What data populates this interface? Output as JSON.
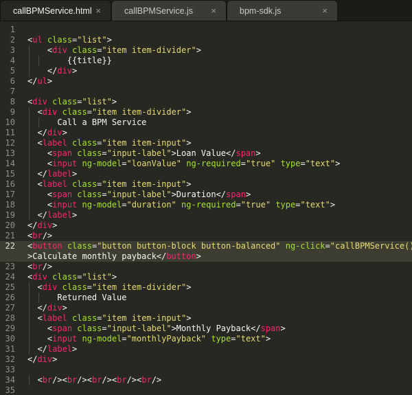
{
  "tabs": [
    {
      "label": "callBPMService.html",
      "close": "×",
      "active": true
    },
    {
      "label": "callBPMService.js",
      "close": "×",
      "active": false
    },
    {
      "label": "bpm-sdk.js",
      "close": "×",
      "active": false
    }
  ],
  "editor": {
    "current_line": 22,
    "lines": [
      {
        "n": "1",
        "indent": 0,
        "tokens": []
      },
      {
        "n": "2",
        "indent": 0,
        "tokens": [
          [
            "p",
            "<"
          ],
          [
            "t",
            "ul"
          ],
          [
            "p",
            " "
          ],
          [
            "a",
            "class"
          ],
          [
            "p",
            "="
          ],
          [
            "s",
            "\"list\""
          ],
          [
            "p",
            ">"
          ]
        ]
      },
      {
        "n": "3",
        "indent": 2,
        "tokens": [
          [
            "p",
            "<"
          ],
          [
            "t",
            "div"
          ],
          [
            "p",
            " "
          ],
          [
            "a",
            "class"
          ],
          [
            "p",
            "="
          ],
          [
            "s",
            "\"item item-divider\""
          ],
          [
            "p",
            ">"
          ]
        ]
      },
      {
        "n": "4",
        "indent": 4,
        "tokens": [
          [
            "p",
            "{{title}}"
          ]
        ]
      },
      {
        "n": "5",
        "indent": 2,
        "tokens": [
          [
            "p",
            "</"
          ],
          [
            "t",
            "div"
          ],
          [
            "p",
            ">"
          ]
        ]
      },
      {
        "n": "6",
        "indent": 0,
        "tokens": [
          [
            "p",
            "</"
          ],
          [
            "t",
            "ul"
          ],
          [
            "p",
            ">"
          ]
        ]
      },
      {
        "n": "7",
        "indent": 0,
        "tokens": []
      },
      {
        "n": "8",
        "indent": 0,
        "tokens": [
          [
            "p",
            "<"
          ],
          [
            "t",
            "div"
          ],
          [
            "p",
            " "
          ],
          [
            "a",
            "class"
          ],
          [
            "p",
            "="
          ],
          [
            "s",
            "\"list\""
          ],
          [
            "p",
            ">"
          ]
        ]
      },
      {
        "n": "9",
        "indent": 1,
        "tokens": [
          [
            "p",
            "<"
          ],
          [
            "t",
            "div"
          ],
          [
            "p",
            " "
          ],
          [
            "a",
            "class"
          ],
          [
            "p",
            "="
          ],
          [
            "s",
            "\"item item-divider\""
          ],
          [
            "p",
            ">"
          ]
        ]
      },
      {
        "n": "10",
        "indent": 3,
        "tokens": [
          [
            "p",
            "Call a BPM Service"
          ]
        ]
      },
      {
        "n": "11",
        "indent": 1,
        "tokens": [
          [
            "p",
            "</"
          ],
          [
            "t",
            "div"
          ],
          [
            "p",
            ">"
          ]
        ]
      },
      {
        "n": "12",
        "indent": 1,
        "tokens": [
          [
            "p",
            "<"
          ],
          [
            "t",
            "label"
          ],
          [
            "p",
            " "
          ],
          [
            "a",
            "class"
          ],
          [
            "p",
            "="
          ],
          [
            "s",
            "\"item item-input\""
          ],
          [
            "p",
            ">"
          ]
        ]
      },
      {
        "n": "13",
        "indent": 2,
        "tokens": [
          [
            "p",
            "<"
          ],
          [
            "t",
            "span"
          ],
          [
            "p",
            " "
          ],
          [
            "a",
            "class"
          ],
          [
            "p",
            "="
          ],
          [
            "s",
            "\"input-label\""
          ],
          [
            "p",
            ">Loan Value</"
          ],
          [
            "t",
            "span"
          ],
          [
            "p",
            ">"
          ]
        ]
      },
      {
        "n": "14",
        "indent": 2,
        "tokens": [
          [
            "p",
            "<"
          ],
          [
            "t",
            "input"
          ],
          [
            "p",
            " "
          ],
          [
            "a",
            "ng-model"
          ],
          [
            "p",
            "="
          ],
          [
            "s",
            "\"loanValue\""
          ],
          [
            "p",
            " "
          ],
          [
            "a",
            "ng-required"
          ],
          [
            "p",
            "="
          ],
          [
            "s",
            "\"true\""
          ],
          [
            "p",
            " "
          ],
          [
            "a",
            "type"
          ],
          [
            "p",
            "="
          ],
          [
            "s",
            "\"text\""
          ],
          [
            "p",
            ">"
          ]
        ]
      },
      {
        "n": "15",
        "indent": 1,
        "tokens": [
          [
            "p",
            "</"
          ],
          [
            "t",
            "label"
          ],
          [
            "p",
            ">"
          ]
        ]
      },
      {
        "n": "16",
        "indent": 1,
        "tokens": [
          [
            "p",
            "<"
          ],
          [
            "t",
            "label"
          ],
          [
            "p",
            " "
          ],
          [
            "a",
            "class"
          ],
          [
            "p",
            "="
          ],
          [
            "s",
            "\"item item-input\""
          ],
          [
            "p",
            ">"
          ]
        ]
      },
      {
        "n": "17",
        "indent": 2,
        "tokens": [
          [
            "p",
            "<"
          ],
          [
            "t",
            "span"
          ],
          [
            "p",
            " "
          ],
          [
            "a",
            "class"
          ],
          [
            "p",
            "="
          ],
          [
            "s",
            "\"input-label\""
          ],
          [
            "p",
            ">Duration</"
          ],
          [
            "t",
            "span"
          ],
          [
            "p",
            ">"
          ]
        ]
      },
      {
        "n": "18",
        "indent": 2,
        "tokens": [
          [
            "p",
            "<"
          ],
          [
            "t",
            "input"
          ],
          [
            "p",
            " "
          ],
          [
            "a",
            "ng-model"
          ],
          [
            "p",
            "="
          ],
          [
            "s",
            "\"duration\""
          ],
          [
            "p",
            " "
          ],
          [
            "a",
            "ng-required"
          ],
          [
            "p",
            "="
          ],
          [
            "s",
            "\"true\""
          ],
          [
            "p",
            " "
          ],
          [
            "a",
            "type"
          ],
          [
            "p",
            "="
          ],
          [
            "s",
            "\"text\""
          ],
          [
            "p",
            ">"
          ]
        ]
      },
      {
        "n": "19",
        "indent": 1,
        "tokens": [
          [
            "p",
            "</"
          ],
          [
            "t",
            "label"
          ],
          [
            "p",
            ">"
          ]
        ]
      },
      {
        "n": "20",
        "indent": 0,
        "tokens": [
          [
            "p",
            "</"
          ],
          [
            "t",
            "div"
          ],
          [
            "p",
            ">"
          ]
        ]
      },
      {
        "n": "21",
        "indent": 0,
        "tokens": [
          [
            "p",
            "<"
          ],
          [
            "t",
            "br"
          ],
          [
            "p",
            "/>"
          ]
        ]
      },
      {
        "n": "22",
        "indent": 0,
        "tokens": [
          [
            "p",
            "<"
          ],
          [
            "t",
            "button"
          ],
          [
            "p",
            " "
          ],
          [
            "a",
            "class"
          ],
          [
            "p",
            "="
          ],
          [
            "s",
            "\"button button-block button-balanced\""
          ],
          [
            "p",
            " "
          ],
          [
            "a",
            "ng-click"
          ],
          [
            "p",
            "="
          ],
          [
            "s",
            "\"callBPMService();\""
          ]
        ]
      },
      {
        "n": "",
        "indent": 0,
        "tokens": [
          [
            "p",
            ">Calculate monthly payback</"
          ],
          [
            "t",
            "button"
          ],
          [
            "p",
            ">"
          ]
        ]
      },
      {
        "n": "23",
        "indent": 0,
        "tokens": [
          [
            "p",
            "<"
          ],
          [
            "t",
            "br"
          ],
          [
            "p",
            "/>"
          ]
        ]
      },
      {
        "n": "24",
        "indent": 0,
        "tokens": [
          [
            "p",
            "<"
          ],
          [
            "t",
            "div"
          ],
          [
            "p",
            " "
          ],
          [
            "a",
            "class"
          ],
          [
            "p",
            "="
          ],
          [
            "s",
            "\"list\""
          ],
          [
            "p",
            ">"
          ]
        ]
      },
      {
        "n": "25",
        "indent": 1,
        "tokens": [
          [
            "p",
            "<"
          ],
          [
            "t",
            "div"
          ],
          [
            "p",
            " "
          ],
          [
            "a",
            "class"
          ],
          [
            "p",
            "="
          ],
          [
            "s",
            "\"item item-divider\""
          ],
          [
            "p",
            ">"
          ]
        ]
      },
      {
        "n": "26",
        "indent": 3,
        "tokens": [
          [
            "p",
            "Returned Value"
          ]
        ]
      },
      {
        "n": "27",
        "indent": 1,
        "tokens": [
          [
            "p",
            "</"
          ],
          [
            "t",
            "div"
          ],
          [
            "p",
            ">"
          ]
        ]
      },
      {
        "n": "28",
        "indent": 1,
        "tokens": [
          [
            "p",
            "<"
          ],
          [
            "t",
            "label"
          ],
          [
            "p",
            " "
          ],
          [
            "a",
            "class"
          ],
          [
            "p",
            "="
          ],
          [
            "s",
            "\"item item-input\""
          ],
          [
            "p",
            ">"
          ]
        ]
      },
      {
        "n": "29",
        "indent": 2,
        "tokens": [
          [
            "p",
            "<"
          ],
          [
            "t",
            "span"
          ],
          [
            "p",
            " "
          ],
          [
            "a",
            "class"
          ],
          [
            "p",
            "="
          ],
          [
            "s",
            "\"input-label\""
          ],
          [
            "p",
            ">Monthly Payback</"
          ],
          [
            "t",
            "span"
          ],
          [
            "p",
            ">"
          ]
        ]
      },
      {
        "n": "30",
        "indent": 2,
        "tokens": [
          [
            "p",
            "<"
          ],
          [
            "t",
            "input"
          ],
          [
            "p",
            " "
          ],
          [
            "a",
            "ng-model"
          ],
          [
            "p",
            "="
          ],
          [
            "s",
            "\"monthlyPayback\""
          ],
          [
            "p",
            " "
          ],
          [
            "a",
            "type"
          ],
          [
            "p",
            "="
          ],
          [
            "s",
            "\"text\""
          ],
          [
            "p",
            ">"
          ]
        ]
      },
      {
        "n": "31",
        "indent": 1,
        "tokens": [
          [
            "p",
            "</"
          ],
          [
            "t",
            "label"
          ],
          [
            "p",
            ">"
          ]
        ]
      },
      {
        "n": "32",
        "indent": 0,
        "tokens": [
          [
            "p",
            "</"
          ],
          [
            "t",
            "div"
          ],
          [
            "p",
            ">"
          ]
        ]
      },
      {
        "n": "33",
        "indent": 0,
        "tokens": []
      },
      {
        "n": "34",
        "indent": 1,
        "tokens": [
          [
            "p",
            "<"
          ],
          [
            "t",
            "br"
          ],
          [
            "p",
            "/><"
          ],
          [
            "t",
            "br"
          ],
          [
            "p",
            "/><"
          ],
          [
            "t",
            "br"
          ],
          [
            "p",
            "/><"
          ],
          [
            "t",
            "br"
          ],
          [
            "p",
            "/><"
          ],
          [
            "t",
            "br"
          ],
          [
            "p",
            "/>"
          ]
        ]
      },
      {
        "n": "35",
        "indent": 0,
        "tokens": []
      }
    ]
  }
}
